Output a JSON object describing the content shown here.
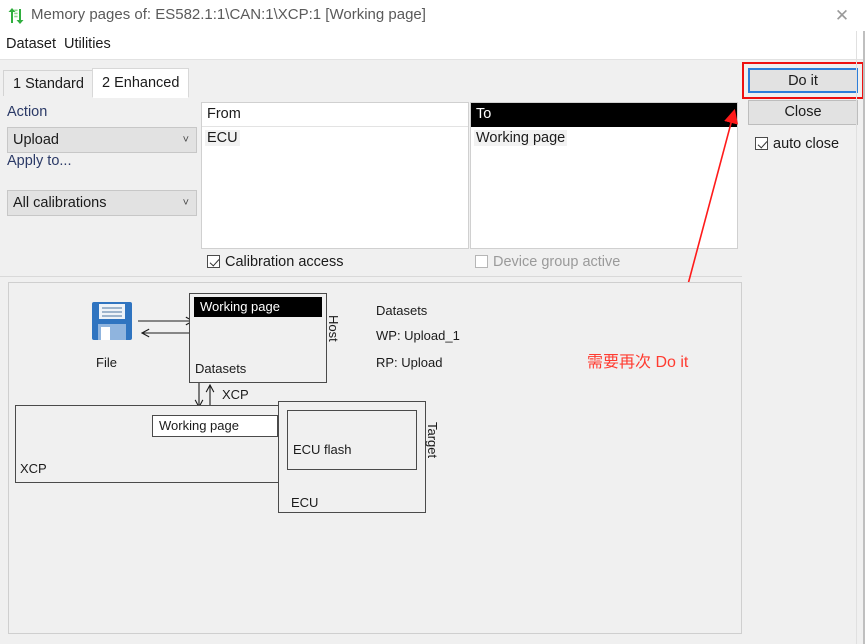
{
  "window": {
    "title": "Memory pages of: ES582.1:1\\CAN:1\\XCP:1 [Working page]",
    "icon": "transfer-arrows-icon",
    "close_label": "✕"
  },
  "menubar": {
    "items": [
      {
        "label": "Dataset"
      },
      {
        "label": "Utilities"
      }
    ]
  },
  "tabs": [
    {
      "label": "1 Standard",
      "active": false
    },
    {
      "label": "2 Enhanced",
      "active": true
    }
  ],
  "form": {
    "action_label": "Action",
    "action_value": "Upload",
    "apply_to_label": "Apply to...",
    "apply_to_value": "All calibrations",
    "from": {
      "header": "From",
      "header_selected": false,
      "items": [
        "ECU"
      ]
    },
    "to": {
      "header": "To",
      "header_selected": true,
      "items": [
        "Working page"
      ]
    },
    "checkboxes": [
      {
        "label": "Calibration access",
        "checked": true,
        "disabled": false
      },
      {
        "label": "Device group active",
        "checked": false,
        "disabled": true
      }
    ]
  },
  "actions": {
    "do_it_label": "Do it",
    "close_label": "Close",
    "auto_close_label": "auto close",
    "auto_close_checked": true,
    "highlight_color": "#ee1111",
    "focus_color": "#2d7ed9"
  },
  "diagram": {
    "file_label": "File",
    "file_icon": "floppy-disk-icon",
    "host_label": "Host",
    "target_label": "Target",
    "datasets_box": {
      "selected_item": "Working page",
      "caption": "Datasets"
    },
    "xcp_link_label": "XCP",
    "host_info": {
      "datasets": "Datasets",
      "wp": "WP: Upload_1",
      "rp": "RP: Upload"
    },
    "xcp_box": {
      "caption": "XCP",
      "inner_label": "Working page"
    },
    "ecu_box": {
      "caption": "ECU",
      "inner_label": "ECU flash"
    },
    "annotation": {
      "text": "需要再次 Do it",
      "color": "#ff3b30"
    }
  }
}
